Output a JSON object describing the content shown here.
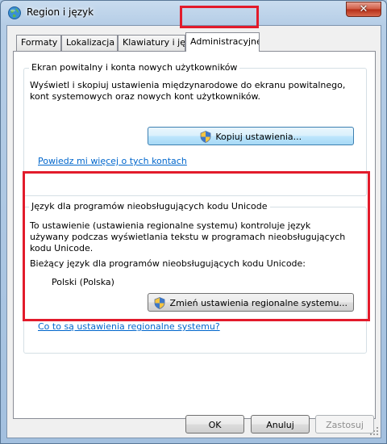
{
  "window": {
    "title": "Region i język",
    "close_symbol": "✕"
  },
  "tabs": [
    {
      "label": "Formaty"
    },
    {
      "label": "Lokalizacja"
    },
    {
      "label": "Klawiatury i języki"
    },
    {
      "label": "Administracyjne"
    }
  ],
  "welcome_group": {
    "caption": "Ekran powitalny i konta nowych użytkowników",
    "description": "Wyświetl i skopiuj ustawienia międzynarodowe do ekranu powitalnego, kont systemowych oraz nowych kont użytkowników.",
    "copy_button": "Kopiuj ustawienia...",
    "link": "Powiedz mi więcej o tych kontach"
  },
  "unicode_group": {
    "caption": "Język dla programów nieobsługujących kodu Unicode",
    "description": "To ustawienie (ustawienia regionalne systemu) kontroluje język używany podczas wyświetlania tekstu w programach nieobsługujących kodu Unicode.",
    "current_label": "Bieżący język dla programów nieobsługujących kodu Unicode:",
    "current_value": "Polski (Polska)",
    "change_button": "Zmień ustawienia regionalne systemu...",
    "link": "Co to są ustawienia regionalne systemu?"
  },
  "footer": {
    "ok": "OK",
    "cancel": "Anuluj",
    "apply": "Zastosuj"
  },
  "colors": {
    "highlight": "#e21b2b",
    "link": "#0066cc"
  },
  "icons": [
    "globe-icon",
    "shield-icon",
    "close-icon",
    "resize-grip-icon"
  ]
}
